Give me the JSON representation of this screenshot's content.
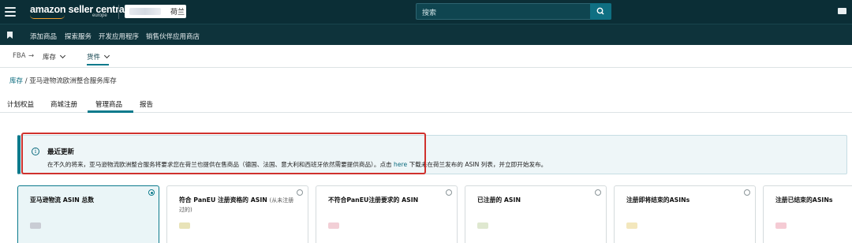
{
  "header": {
    "logo_text": "amazon seller central",
    "logo_sub": "europe",
    "account_label": "荷兰",
    "search_placeholder": "搜索"
  },
  "nav": {
    "items": [
      "添加商品",
      "探索服务",
      "开发应用程序",
      "销售伙伴应用商店"
    ]
  },
  "breadcrumb_bar": {
    "fba": "FBA",
    "inventory": "库存",
    "shipments": "货件"
  },
  "page": {
    "crumb_link": "库存",
    "crumb_rest": " / 亚马逊物流欧洲整合服务库存"
  },
  "tabs": [
    "计划权益",
    "商城注册",
    "管理商品",
    "报告"
  ],
  "alert": {
    "title": "最近更新",
    "body_pre": "在不久的将来，亚马逊物流欧洲整合服务将要求您在荷兰也提供在售商品（德国、法国、意大利和西班牙依然需要提供商品）。点击 ",
    "body_link": "here",
    "body_post": " 下载未在荷兰发布的 ASIN 列表，并立即开始发布。"
  },
  "cards": [
    {
      "title": "亚马逊物流 ASIN 总数",
      "selected": true
    },
    {
      "title": "符合 PanEU 注册资格的 ASIN",
      "sub": "(从未注册",
      "line2": "过的)",
      "selected": false
    },
    {
      "title": "不符合PanEU注册要求的 ASIN",
      "selected": false
    },
    {
      "title": "已注册的 ASIN",
      "selected": false
    },
    {
      "title": "注册即将结束的ASINs",
      "selected": false
    },
    {
      "title": "注册已结束的ASINs",
      "selected": false
    }
  ],
  "colors": {
    "topbar": "#0b2e36",
    "accent": "#0b7a8c",
    "highlight_border": "#d0312d"
  },
  "icons": [
    "hamburger-icon",
    "search-icon",
    "mail-icon",
    "bookmark-icon",
    "info-icon",
    "chevron-down-icon"
  ]
}
